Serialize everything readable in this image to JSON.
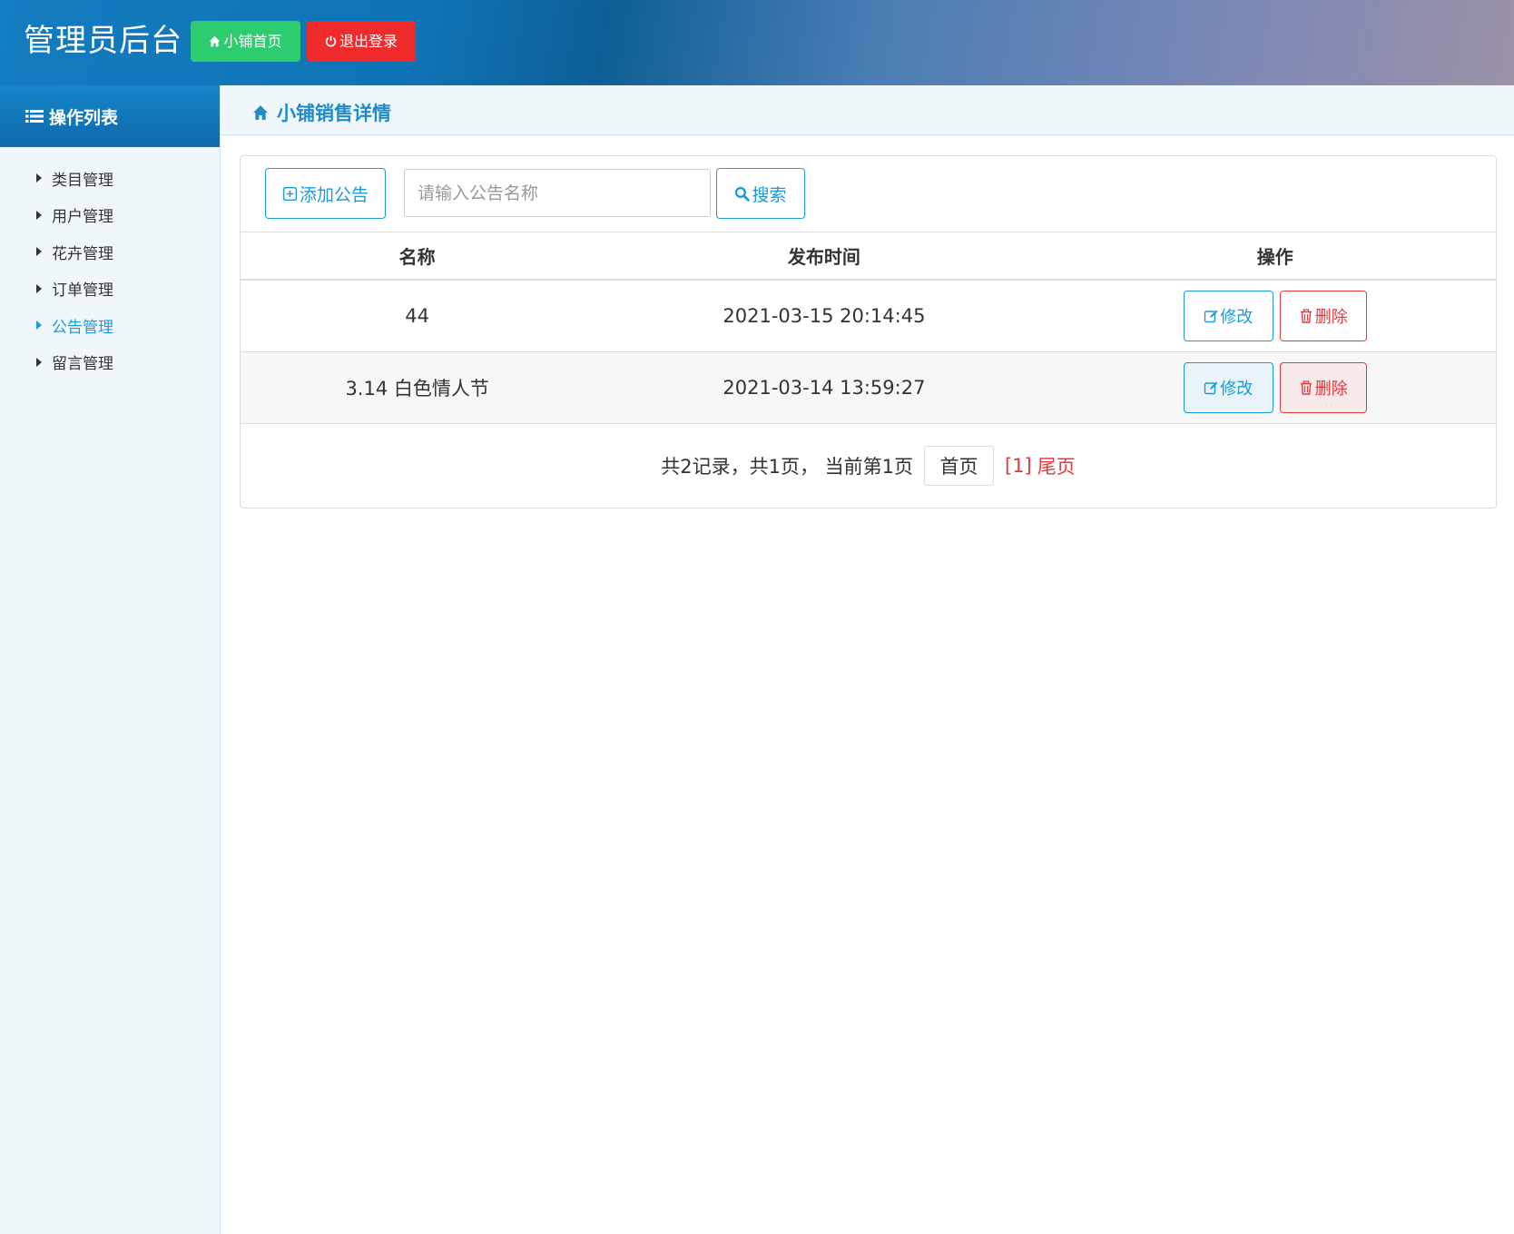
{
  "header": {
    "title": "管理员后台",
    "home_label": "小铺首页",
    "logout_label": "退出登录"
  },
  "sidebar": {
    "title": "操作列表",
    "items": [
      {
        "label": "类目管理",
        "active": false
      },
      {
        "label": "用户管理",
        "active": false
      },
      {
        "label": "花卉管理",
        "active": false
      },
      {
        "label": "订单管理",
        "active": false
      },
      {
        "label": "公告管理",
        "active": true
      },
      {
        "label": "留言管理",
        "active": false
      }
    ]
  },
  "page": {
    "title": "小铺销售详情"
  },
  "toolbar": {
    "add_label": "添加公告",
    "search_placeholder": "请输入公告名称",
    "search_label": "搜索"
  },
  "table": {
    "columns": [
      "名称",
      "发布时间",
      "操作"
    ],
    "rows": [
      {
        "name": "44",
        "time": "2021-03-15 20:14:45"
      },
      {
        "name": "3.14 白色情人节",
        "time": "2021-03-14 13:59:27"
      }
    ],
    "edit_label": "修改",
    "delete_label": "删除"
  },
  "pager": {
    "info": "共2记录，共1页， 当前第1页",
    "first_label": "首页",
    "current": "[1]",
    "last_label": "尾页"
  },
  "colors": {
    "accent": "#1a9bd7",
    "home_button": "#2dcc70",
    "logout_button": "#ef2b2b",
    "danger": "#e4393c"
  },
  "icons": {
    "home": "home-icon",
    "logout": "power-icon",
    "list": "list-icon",
    "add": "plus-square-icon",
    "search": "search-icon",
    "edit": "edit-icon",
    "delete": "trash-icon"
  }
}
